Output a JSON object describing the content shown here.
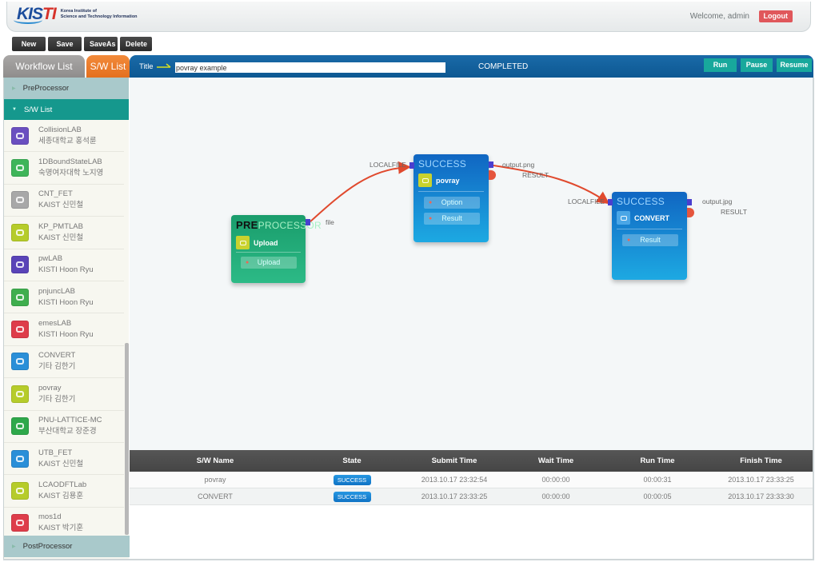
{
  "header": {
    "logo_mark": "KISTI",
    "logo_line1": "Korea Institute of",
    "logo_line2": "Science and Technology Information",
    "welcome": "Welcome, admin",
    "logout_label": "Logout"
  },
  "toolbar": {
    "new_label": "New",
    "save_label": "Save",
    "saveas_label": "SaveAs",
    "delete_label": "Delete"
  },
  "left_tabs": {
    "workflow_list": "Workflow  List",
    "sw_list": "S/W List"
  },
  "sidebar": {
    "pre_processor": "PreProcessor",
    "sw_list": "S/W List",
    "post_processor": "PostProcessor",
    "items": [
      {
        "name": "CollisionLAB",
        "owner": "세종대학교  홍석륜",
        "color": "#6a4fc0"
      },
      {
        "name": "1DBoundStateLAB",
        "owner": "숙명여자대학  노지영",
        "color": "#3fb55a"
      },
      {
        "name": "CNT_FET",
        "owner": "KAIST  신민철",
        "color": "#a8a8a8"
      },
      {
        "name": "KP_PMTLAB",
        "owner": "KAIST  신민철",
        "color": "#b6cc2a"
      },
      {
        "name": "pwLAB",
        "owner": "KISTI  Hoon Ryu",
        "color": "#5a44b8"
      },
      {
        "name": "pnjuncLAB",
        "owner": "KISTI  Hoon Ryu",
        "color": "#3fae4e"
      },
      {
        "name": "emesLAB",
        "owner": "KISTI  Hoon Ryu",
        "color": "#de3d4a"
      },
      {
        "name": "CONVERT",
        "owner": "기타  김한기",
        "color": "#2a8fd8"
      },
      {
        "name": "povray",
        "owner": "기타  김한기",
        "color": "#b6cc2a"
      },
      {
        "name": "PNU-LATTICE-MC",
        "owner": "부산대학교  장준경",
        "color": "#2ea84a"
      },
      {
        "name": "UTB_FET",
        "owner": "KAIST  신민철",
        "color": "#2a8fd8"
      },
      {
        "name": "LCAODFTLab",
        "owner": "KAIST  김용훈",
        "color": "#b6cc2a"
      },
      {
        "name": "mos1d",
        "owner": "KAIST  박기훈",
        "color": "#de3d4a"
      }
    ]
  },
  "workflow": {
    "title_label": "Title",
    "title_value": "povray example",
    "status": "COMPLETED",
    "run_label": "Run",
    "pause_label": "Pause",
    "resume_label": "Resume"
  },
  "nodes": {
    "upload": {
      "head_pre": "PRE",
      "head_rest": "PROCESSOR",
      "name": "Upload",
      "items": [
        "Upload"
      ],
      "out_port": "file",
      "icon_color": "#c9d22e"
    },
    "povray": {
      "state": "SUCCESS",
      "name": "povray",
      "items": [
        "Option",
        "Result"
      ],
      "in_port": "LOCALFILE",
      "out_port": "output.png",
      "result_port": "RESULT",
      "icon_color": "#c9d22e"
    },
    "convert": {
      "state": "SUCCESS",
      "name": "CONVERT",
      "items": [
        "Result"
      ],
      "in_port": "LOCALFILE",
      "out_port": "output.jpg",
      "result_port": "RESULT",
      "icon_color": "#4aa6e6"
    }
  },
  "jobs": {
    "columns": [
      "S/W Name",
      "State",
      "Submit Time",
      "Wait Time",
      "Run Time",
      "Finish Time"
    ],
    "rows": [
      {
        "name": "povray",
        "state": "SUCCESS",
        "submit": "2013.10.17 23:32:54",
        "wait": "00:00:00",
        "run": "00:00:31",
        "finish": "2013.10.17 23:33:25"
      },
      {
        "name": "CONVERT",
        "state": "SUCCESS",
        "submit": "2013.10.17 23:33:25",
        "wait": "00:00:00",
        "run": "00:00:05",
        "finish": "2013.10.17 23:33:30"
      }
    ]
  }
}
